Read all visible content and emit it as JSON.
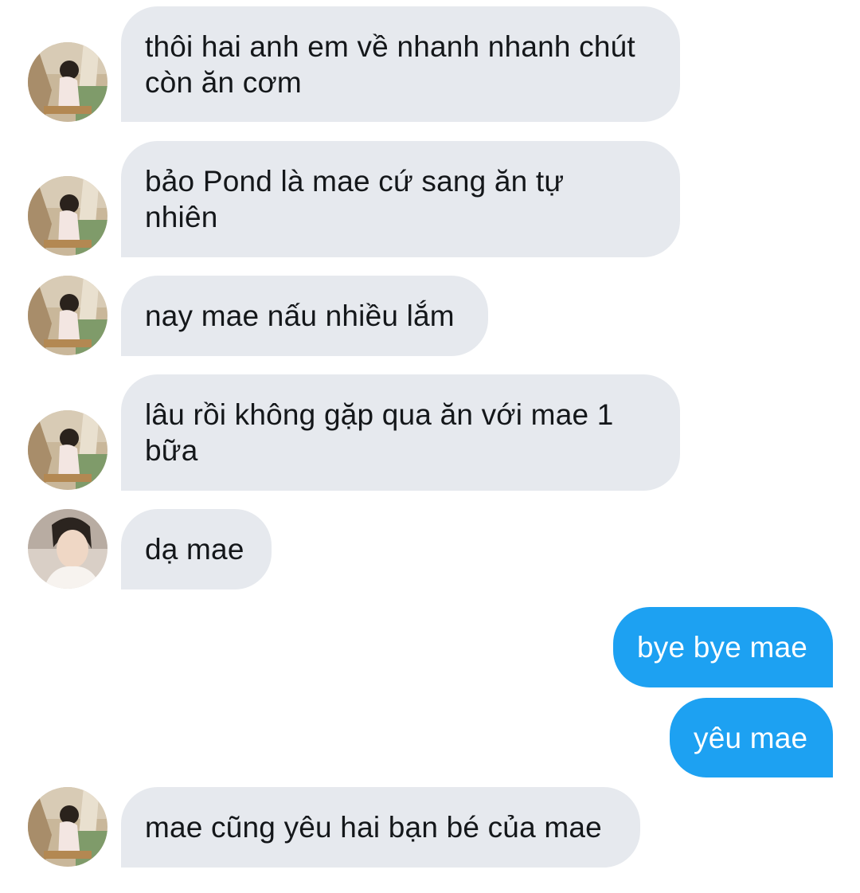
{
  "conversation": {
    "messages": [
      {
        "sender": "mae",
        "avatar": "mother-avatar",
        "lines": [
          "thôi hai anh em về nhanh nhanh chút",
          "còn ăn cơm"
        ]
      },
      {
        "sender": "mae",
        "avatar": "mother-avatar",
        "lines": [
          "bảo Pond là mae cứ sang ăn tự",
          "nhiên"
        ]
      },
      {
        "sender": "mae",
        "avatar": "mother-avatar",
        "lines": [
          "nay mae nấu nhiều lắm"
        ]
      },
      {
        "sender": "mae",
        "avatar": "mother-avatar",
        "lines": [
          "lâu rồi không gặp qua ăn với mae 1",
          "bữa"
        ]
      },
      {
        "sender": "other",
        "avatar": "young-man-avatar",
        "lines": [
          "dạ mae"
        ]
      },
      {
        "sender": "me",
        "lines": [
          "bye bye mae"
        ]
      },
      {
        "sender": "me",
        "lines": [
          "yêu mae"
        ]
      },
      {
        "sender": "mae",
        "avatar": "mother-avatar",
        "lines": [
          "mae cũng yêu hai bạn bé của mae"
        ]
      }
    ]
  },
  "colors": {
    "incoming_bubble": "#e6e9ee",
    "outgoing_bubble": "#1da1f2",
    "incoming_text": "#14171a",
    "outgoing_text": "#ffffff"
  }
}
